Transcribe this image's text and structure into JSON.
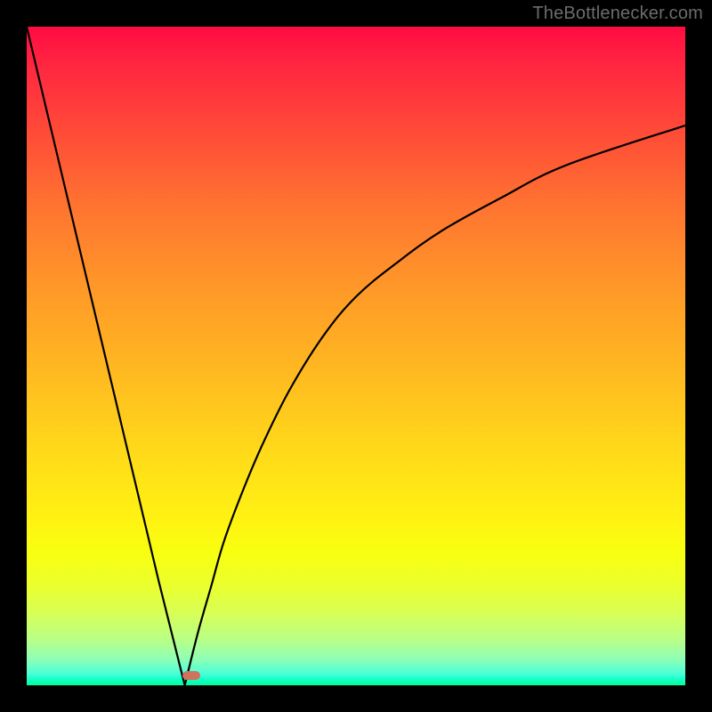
{
  "watermark": "TheBottlenecker.com",
  "chart_data": {
    "type": "line",
    "title": "",
    "xlabel": "",
    "ylabel": "",
    "xlim": [
      0,
      100
    ],
    "ylim": [
      0,
      100
    ],
    "notes": "V-shaped bottleneck curve over a vertical heat gradient (red at top through orange/yellow to green at bottom). Minimum at roughly x≈25 near y≈0 with a small salmon pill marker. Left branch is near-linear from top-left corner down to the minimum. Right branch rises with decreasing slope toward y≈85 at the right edge. Axes are unlabeled so values are normalized 0–100.",
    "series": [
      {
        "name": "left-branch",
        "x": [
          0,
          5,
          10,
          15,
          20,
          24
        ],
        "values": [
          100,
          79,
          58,
          37,
          16,
          0
        ]
      },
      {
        "name": "right-branch",
        "x": [
          24,
          26,
          28,
          30,
          33,
          36,
          40,
          45,
          50,
          56,
          63,
          72,
          82,
          100
        ],
        "values": [
          0,
          8,
          15,
          22,
          30,
          37,
          45,
          53,
          59,
          64,
          69,
          74,
          79,
          85
        ]
      }
    ],
    "marker": {
      "x": 25,
      "y": 1.5,
      "shape": "pill",
      "color": "#cf735e"
    },
    "background_gradient": {
      "direction": "vertical",
      "stops": [
        {
          "pos": 0.0,
          "color": "#ff0b42"
        },
        {
          "pos": 0.4,
          "color": "#ff9928"
        },
        {
          "pos": 0.75,
          "color": "#fff312"
        },
        {
          "pos": 1.0,
          "color": "#00ff95"
        }
      ]
    }
  }
}
